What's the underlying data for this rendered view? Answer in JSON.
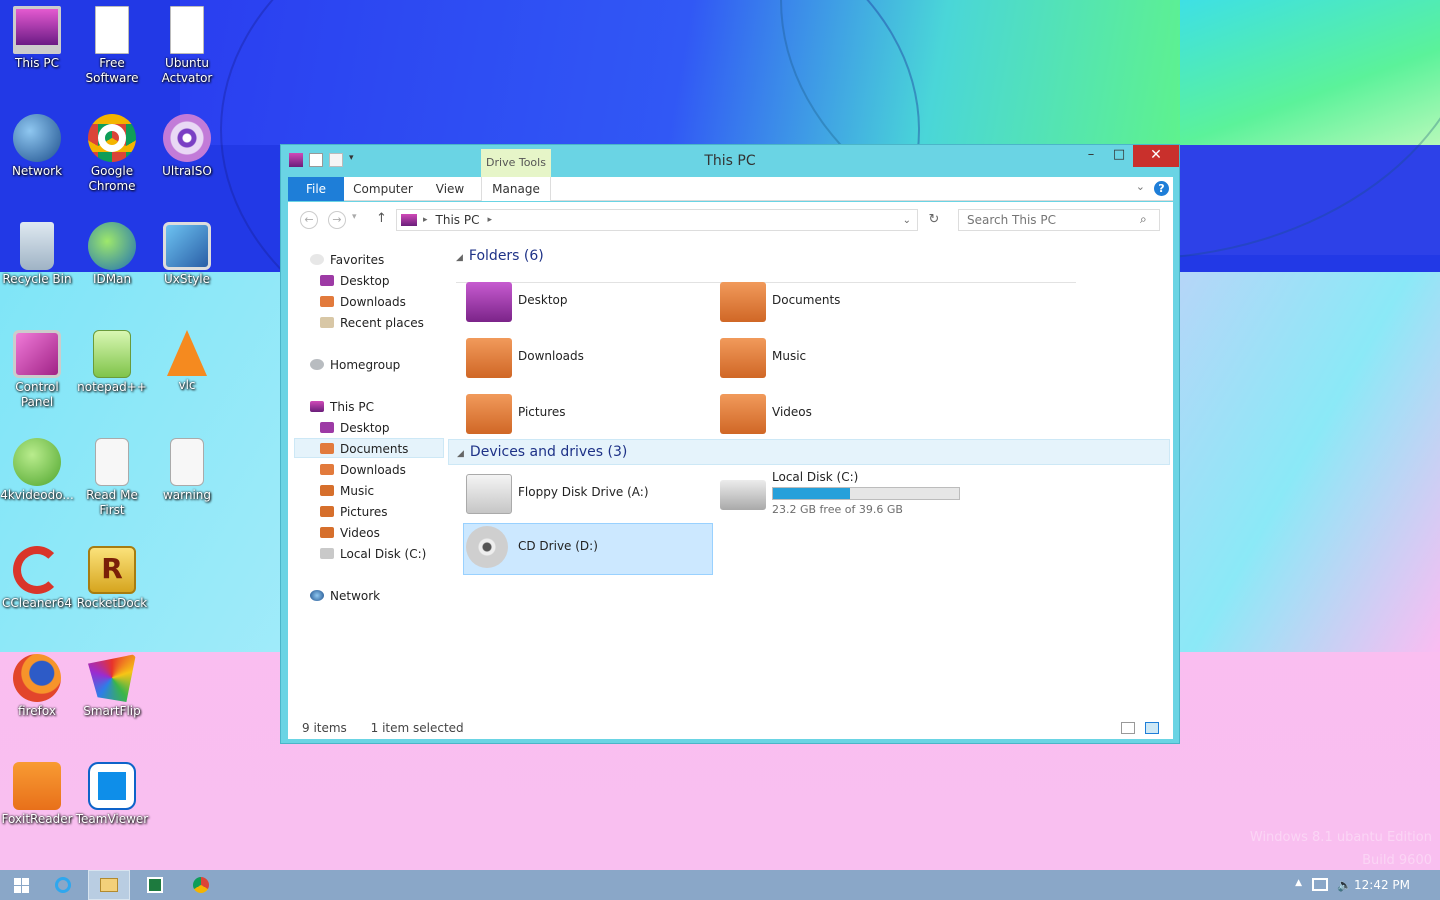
{
  "desktop": {
    "icons": [
      {
        "label": "This PC",
        "icon": "this-pc-icon"
      },
      {
        "label": "Free Software",
        "icon": "document-icon"
      },
      {
        "label": "Ubuntu Actvator",
        "icon": "document-icon"
      },
      {
        "label": "Network",
        "icon": "network-icon"
      },
      {
        "label": "Google Chrome",
        "icon": "chrome-icon"
      },
      {
        "label": "UltraISO",
        "icon": "disc-icon"
      },
      {
        "label": "Recycle Bin",
        "icon": "recycle-bin-icon"
      },
      {
        "label": "IDMan",
        "icon": "idm-icon"
      },
      {
        "label": "UxStyle",
        "icon": "uxstyle-icon"
      },
      {
        "label": "Control Panel",
        "icon": "control-panel-icon"
      },
      {
        "label": "notepad++",
        "icon": "notepad-icon"
      },
      {
        "label": "vlc",
        "icon": "vlc-icon"
      },
      {
        "label": "4kvideodo...",
        "icon": "downloader-icon"
      },
      {
        "label": "Read Me First",
        "icon": "text-file-icon"
      },
      {
        "label": "warning",
        "icon": "text-file-icon"
      },
      {
        "label": "CCleaner64",
        "icon": "ccleaner-icon"
      },
      {
        "label": "RocketDock",
        "icon": "rocketdock-icon"
      },
      {
        "label": "firefox",
        "icon": "firefox-icon"
      },
      {
        "label": "SmartFlip",
        "icon": "smartflip-icon"
      },
      {
        "label": "FoxitReader",
        "icon": "foxit-icon"
      },
      {
        "label": "TeamViewer",
        "icon": "teamviewer-icon"
      }
    ],
    "watermark_line1": "Windows 8.1 ubantu Edition",
    "watermark_line2": "Build 9600"
  },
  "window": {
    "title": "This PC",
    "context_tab": "Drive Tools",
    "ribbon_tabs": [
      "File",
      "Computer",
      "View",
      "Manage"
    ],
    "address_path": "This PC",
    "search_placeholder": "Search This PC",
    "nav": {
      "favorites": "Favorites",
      "fav_items": [
        "Desktop",
        "Downloads",
        "Recent places"
      ],
      "homegroup": "Homegroup",
      "this_pc": "This PC",
      "pc_items": [
        "Desktop",
        "Documents",
        "Downloads",
        "Music",
        "Pictures",
        "Videos",
        "Local Disk (C:)"
      ],
      "network": "Network"
    },
    "folders_header": "Folders (6)",
    "folders": [
      "Desktop",
      "Documents",
      "Downloads",
      "Music",
      "Pictures",
      "Videos"
    ],
    "devices_header": "Devices and drives (3)",
    "devices": {
      "floppy": "Floppy Disk Drive (A:)",
      "local_disk": "Local Disk (C:)",
      "local_disk_free": "23.2 GB free of 39.6 GB",
      "local_disk_used_fraction": 0.414,
      "cd_drive": "CD Drive (D:)"
    },
    "status_items": "9 items",
    "status_selected": "1 item selected"
  },
  "taskbar": {
    "clock": "12:42 PM"
  },
  "colors": {
    "accent": "#1e7ed8",
    "window_frame": "#6ad4e4",
    "drive_bar": "#26a0da"
  }
}
